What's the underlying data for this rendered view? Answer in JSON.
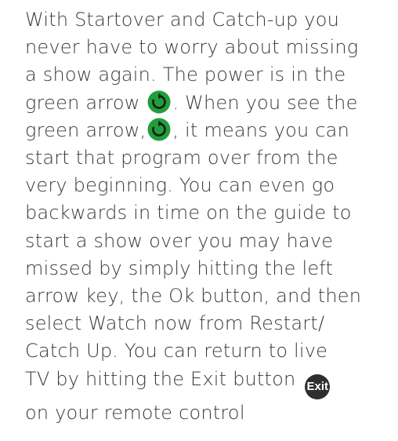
{
  "body": {
    "l1": "With Startover and Catch-up you",
    "l2": "never have to worry about missing",
    "l3": "a show again. The power is in the",
    "l4a": "green arrow ",
    "l4b": ". When you see the",
    "l5a": "green arrow,",
    "l5b": ", it means you can",
    "l6": "start that program over from the",
    "l7": "very beginning.  You can even go",
    "l8": "backwards in time on the guide to",
    "l9": "start a show over you may have",
    "l10": "missed by simply hitting the left",
    "l11": "arrow key, the Ok button, and then",
    "l12": "select Watch now from Restart/",
    "l13": "Catch Up.  You can return to live",
    "l14": "TV by hitting the Exit button ",
    "l15": "on your remote control"
  },
  "icons": {
    "restart": "restart-arrow-icon",
    "restart_color": "#1f9e3a",
    "exit_label": "Exit",
    "exit_color": "#2e2e2e"
  }
}
